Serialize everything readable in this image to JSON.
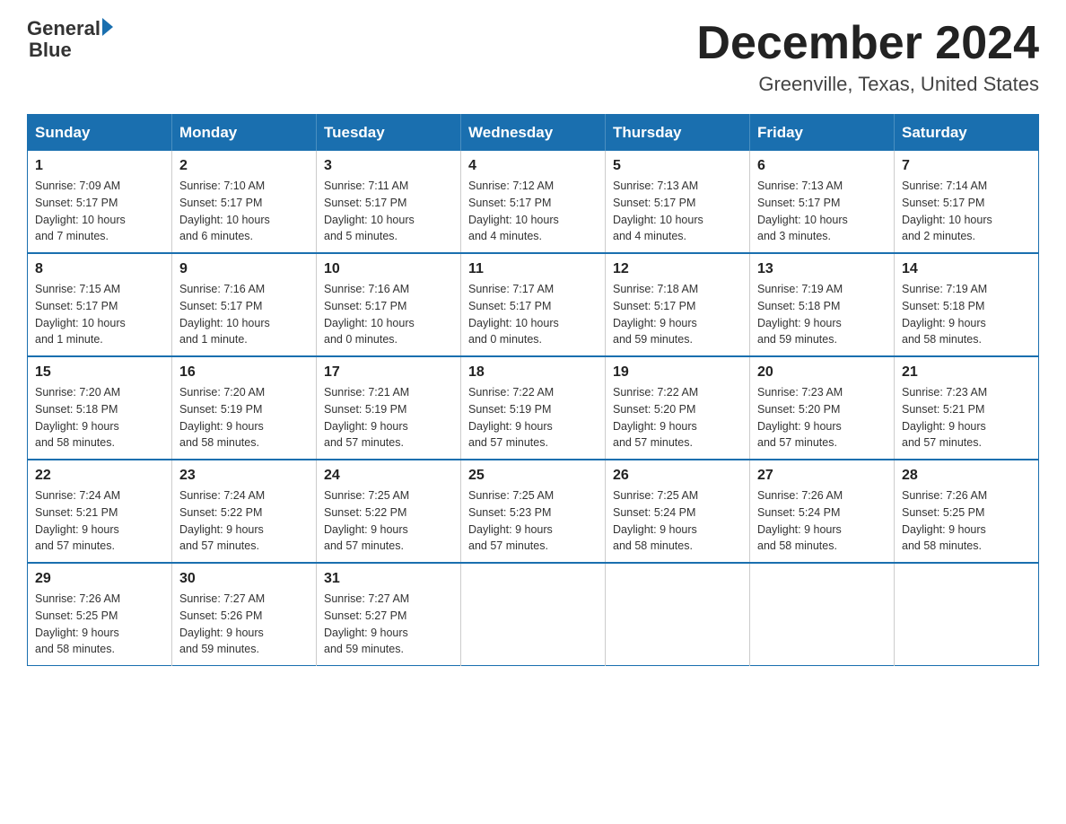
{
  "header": {
    "logo_general": "General",
    "logo_blue": "Blue",
    "month_title": "December 2024",
    "location": "Greenville, Texas, United States"
  },
  "days_of_week": [
    "Sunday",
    "Monday",
    "Tuesday",
    "Wednesday",
    "Thursday",
    "Friday",
    "Saturday"
  ],
  "weeks": [
    [
      {
        "day": "1",
        "sunrise": "7:09 AM",
        "sunset": "5:17 PM",
        "daylight": "10 hours and 7 minutes."
      },
      {
        "day": "2",
        "sunrise": "7:10 AM",
        "sunset": "5:17 PM",
        "daylight": "10 hours and 6 minutes."
      },
      {
        "day": "3",
        "sunrise": "7:11 AM",
        "sunset": "5:17 PM",
        "daylight": "10 hours and 5 minutes."
      },
      {
        "day": "4",
        "sunrise": "7:12 AM",
        "sunset": "5:17 PM",
        "daylight": "10 hours and 4 minutes."
      },
      {
        "day": "5",
        "sunrise": "7:13 AM",
        "sunset": "5:17 PM",
        "daylight": "10 hours and 4 minutes."
      },
      {
        "day": "6",
        "sunrise": "7:13 AM",
        "sunset": "5:17 PM",
        "daylight": "10 hours and 3 minutes."
      },
      {
        "day": "7",
        "sunrise": "7:14 AM",
        "sunset": "5:17 PM",
        "daylight": "10 hours and 2 minutes."
      }
    ],
    [
      {
        "day": "8",
        "sunrise": "7:15 AM",
        "sunset": "5:17 PM",
        "daylight": "10 hours and 1 minute."
      },
      {
        "day": "9",
        "sunrise": "7:16 AM",
        "sunset": "5:17 PM",
        "daylight": "10 hours and 1 minute."
      },
      {
        "day": "10",
        "sunrise": "7:16 AM",
        "sunset": "5:17 PM",
        "daylight": "10 hours and 0 minutes."
      },
      {
        "day": "11",
        "sunrise": "7:17 AM",
        "sunset": "5:17 PM",
        "daylight": "10 hours and 0 minutes."
      },
      {
        "day": "12",
        "sunrise": "7:18 AM",
        "sunset": "5:17 PM",
        "daylight": "9 hours and 59 minutes."
      },
      {
        "day": "13",
        "sunrise": "7:19 AM",
        "sunset": "5:18 PM",
        "daylight": "9 hours and 59 minutes."
      },
      {
        "day": "14",
        "sunrise": "7:19 AM",
        "sunset": "5:18 PM",
        "daylight": "9 hours and 58 minutes."
      }
    ],
    [
      {
        "day": "15",
        "sunrise": "7:20 AM",
        "sunset": "5:18 PM",
        "daylight": "9 hours and 58 minutes."
      },
      {
        "day": "16",
        "sunrise": "7:20 AM",
        "sunset": "5:19 PM",
        "daylight": "9 hours and 58 minutes."
      },
      {
        "day": "17",
        "sunrise": "7:21 AM",
        "sunset": "5:19 PM",
        "daylight": "9 hours and 57 minutes."
      },
      {
        "day": "18",
        "sunrise": "7:22 AM",
        "sunset": "5:19 PM",
        "daylight": "9 hours and 57 minutes."
      },
      {
        "day": "19",
        "sunrise": "7:22 AM",
        "sunset": "5:20 PM",
        "daylight": "9 hours and 57 minutes."
      },
      {
        "day": "20",
        "sunrise": "7:23 AM",
        "sunset": "5:20 PM",
        "daylight": "9 hours and 57 minutes."
      },
      {
        "day": "21",
        "sunrise": "7:23 AM",
        "sunset": "5:21 PM",
        "daylight": "9 hours and 57 minutes."
      }
    ],
    [
      {
        "day": "22",
        "sunrise": "7:24 AM",
        "sunset": "5:21 PM",
        "daylight": "9 hours and 57 minutes."
      },
      {
        "day": "23",
        "sunrise": "7:24 AM",
        "sunset": "5:22 PM",
        "daylight": "9 hours and 57 minutes."
      },
      {
        "day": "24",
        "sunrise": "7:25 AM",
        "sunset": "5:22 PM",
        "daylight": "9 hours and 57 minutes."
      },
      {
        "day": "25",
        "sunrise": "7:25 AM",
        "sunset": "5:23 PM",
        "daylight": "9 hours and 57 minutes."
      },
      {
        "day": "26",
        "sunrise": "7:25 AM",
        "sunset": "5:24 PM",
        "daylight": "9 hours and 58 minutes."
      },
      {
        "day": "27",
        "sunrise": "7:26 AM",
        "sunset": "5:24 PM",
        "daylight": "9 hours and 58 minutes."
      },
      {
        "day": "28",
        "sunrise": "7:26 AM",
        "sunset": "5:25 PM",
        "daylight": "9 hours and 58 minutes."
      }
    ],
    [
      {
        "day": "29",
        "sunrise": "7:26 AM",
        "sunset": "5:25 PM",
        "daylight": "9 hours and 58 minutes."
      },
      {
        "day": "30",
        "sunrise": "7:27 AM",
        "sunset": "5:26 PM",
        "daylight": "9 hours and 59 minutes."
      },
      {
        "day": "31",
        "sunrise": "7:27 AM",
        "sunset": "5:27 PM",
        "daylight": "9 hours and 59 minutes."
      },
      null,
      null,
      null,
      null
    ]
  ],
  "labels": {
    "sunrise": "Sunrise:",
    "sunset": "Sunset:",
    "daylight": "Daylight:"
  }
}
